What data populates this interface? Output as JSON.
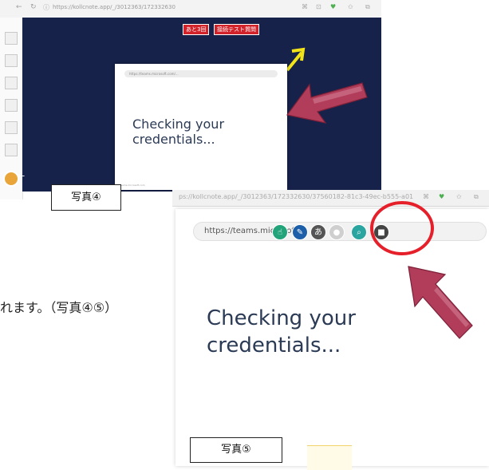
{
  "photo4": {
    "url": "https://kollcnote.app/_/3012363/172332630",
    "red_buttons": [
      "あと3回",
      "接続テスト質問"
    ],
    "card_url": "https://teams.microsoft.com/...",
    "card_text": "Checking your credentials...",
    "card_footer": "teams.microsoft.com",
    "label": "写真④"
  },
  "photo5": {
    "url": "ps://kollcnote.app/_/3012363/172332630/37560182-81c3-49ec-b555-a01",
    "inner_url": "https://teams.microsoft",
    "tools": [
      {
        "icon": "pointer-icon",
        "glyph": "☝",
        "color": "#22a37a"
      },
      {
        "icon": "pen-icon",
        "glyph": "✎",
        "color": "#1c5fa8"
      },
      {
        "icon": "hiragana-icon",
        "glyph": "あ",
        "color": "#555555"
      },
      {
        "icon": "mic-icon",
        "glyph": "●",
        "color": "#cfcfcf"
      },
      {
        "icon": "search-icon",
        "glyph": "⌕",
        "color": "#2aa5a0"
      },
      {
        "icon": "stop-icon",
        "glyph": "■",
        "color": "#444444"
      }
    ],
    "main_text": "Checking your credentials...",
    "label": "写真⑤"
  },
  "body_text": "れます。（写真④⑤）",
  "colors": {
    "stage_background": "#16224a",
    "annotation_arrow": "#b13d5a",
    "highlight_circle": "#e5202a",
    "corner_arrow": "#f3e41a"
  }
}
